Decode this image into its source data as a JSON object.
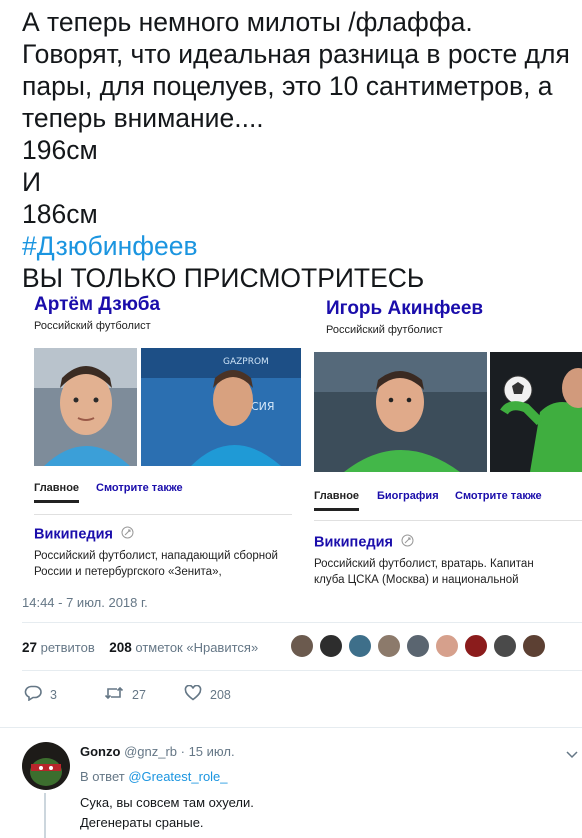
{
  "tweet": {
    "text_main": "А теперь немного милоты /флаффа.\nГоворят, что идеальная разница в росте для пары, для поцелуев, это 10 сантиметров, а теперь внимание....\n196см\nИ\n186см",
    "hashtag": "#Дзюбинфеев",
    "text_end": "ВЫ ТОЛЬКО ПРИСМОТРИТЕСЬ",
    "timestamp": "14:44 - 7 июл. 2018 г."
  },
  "cards": {
    "left": {
      "name": "Артём Дзюба",
      "description": "Российский футболист",
      "tabs": [
        "Главное",
        "Смотрите также"
      ],
      "wiki_title": "Википедия",
      "wiki_text": "Российский футболист, нападающий сборной\nРоссии и петербургского «Зенита»,"
    },
    "right": {
      "name": "Игорь Акинфеев",
      "description": "Российский футболист",
      "tabs": [
        "Главное",
        "Биография",
        "Смотрите также"
      ],
      "wiki_title": "Википедия",
      "wiki_text": "Российский футболист, вратарь. Капитан\nклуба ЦСКА (Москва) и национальной"
    }
  },
  "stats": {
    "retweets_count": "27",
    "retweets_label": "ретвитов",
    "likes_count": "208",
    "likes_label": "отметок «Нравится»"
  },
  "actions": {
    "replies": "3",
    "retweets": "27",
    "likes": "208"
  },
  "reply": {
    "username": "Gonzo",
    "handle": "@gnz_rb",
    "date": "· 15 июл.",
    "in_reply_label": "В ответ",
    "in_reply_handle": "@Greatest_role_",
    "text": "Сука, вы совсем там охуели.\nДегенераты сраные."
  },
  "colors": {
    "link_blue": "#1b95e0",
    "card_link": "#1a0dab",
    "muted": "#657786"
  },
  "icons": [
    "reply-icon",
    "retweet-icon",
    "like-icon",
    "chevron-down-icon",
    "wiki-badge-icon"
  ]
}
